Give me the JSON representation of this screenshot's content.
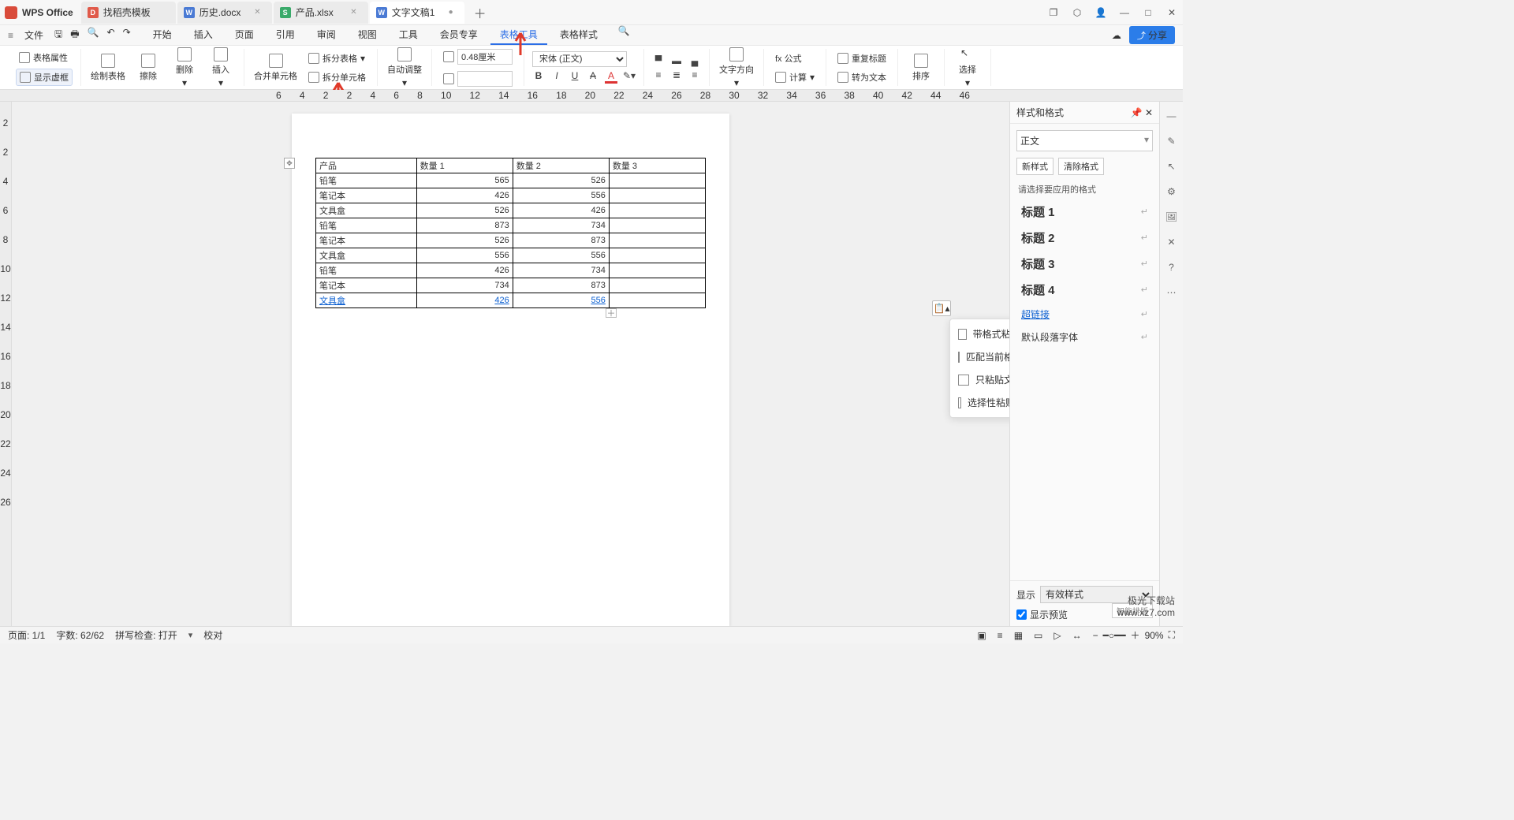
{
  "app": {
    "name": "WPS Office"
  },
  "tabs": [
    {
      "label": "找稻壳模板",
      "icon": "red"
    },
    {
      "label": "历史.docx",
      "icon": "blue"
    },
    {
      "label": "产品.xlsx",
      "icon": "green"
    },
    {
      "label": "文字文稿1",
      "icon": "blue",
      "active": true
    }
  ],
  "win": {
    "box": "❐",
    "cube": "⬚",
    "avatar": "◯",
    "min": "—",
    "max": "❐",
    "close": "✕"
  },
  "qat": {
    "file": "文件"
  },
  "menu": {
    "items": [
      "开始",
      "插入",
      "页面",
      "引用",
      "审阅",
      "视图",
      "工具",
      "会员专享",
      "表格工具",
      "表格样式"
    ],
    "activeIndex": 8
  },
  "menu_right": {
    "share": "分享"
  },
  "ribbon": {
    "tableProps": "表格属性",
    "showBorder": "显示虚框",
    "drawTable": "绘制表格",
    "erase": "擦除",
    "delete": "删除",
    "insert": "插入",
    "merge": "合并单元格",
    "splitTable": "拆分表格",
    "splitCell": "拆分单元格",
    "autoFit": "自动调整",
    "height": "0.48厘米",
    "width": "",
    "font": "宋体 (正文)",
    "fontSize": "",
    "fx": "fx 公式",
    "calc": "计算",
    "repeatHeader": "重复标题",
    "toText": "转为文本",
    "textDir": "文字方向",
    "sort": "排序",
    "select": "选择"
  },
  "ruler_h": [
    "6",
    "4",
    "2",
    "2",
    "4",
    "6",
    "8",
    "10",
    "12",
    "14",
    "16",
    "18",
    "20",
    "22",
    "24",
    "26",
    "28",
    "30",
    "32",
    "34",
    "36",
    "38",
    "40",
    "42",
    "44",
    "46"
  ],
  "ruler_v": [
    "2",
    "2",
    "4",
    "6",
    "8",
    "10",
    "12",
    "14",
    "16",
    "18",
    "20",
    "22",
    "24",
    "26"
  ],
  "table": {
    "headers": [
      "产品",
      "数量 1",
      "数量 2",
      "数量 3"
    ],
    "rows": [
      [
        "铅笔",
        "565",
        "526",
        ""
      ],
      [
        "笔记本",
        "426",
        "556",
        ""
      ],
      [
        "文具盒",
        "526",
        "426",
        ""
      ],
      [
        "铅笔",
        "873",
        "734",
        ""
      ],
      [
        "笔记本",
        "526",
        "873",
        ""
      ],
      [
        "文具盒",
        "556",
        "556",
        ""
      ],
      [
        "铅笔",
        "426",
        "734",
        ""
      ],
      [
        "笔记本",
        "734",
        "873",
        ""
      ],
      [
        "文具盒",
        "426",
        "556",
        ""
      ]
    ],
    "link_row": 8,
    "link_col": 1
  },
  "paste": {
    "withFormat": "带格式粘贴(W)",
    "matchFormat": "匹配当前格式(M)",
    "textOnly": "只粘贴文本(T)",
    "special": "选择性粘贴(S)..."
  },
  "styles": {
    "title": "样式和格式",
    "current": "正文",
    "new": "新样式",
    "clear": "清除格式",
    "hint": "请选择要应用的格式",
    "items": [
      {
        "name": "标题 1",
        "big": true
      },
      {
        "name": "标题 2",
        "big": true
      },
      {
        "name": "标题 3",
        "big": true
      },
      {
        "name": "标题 4",
        "big": true
      },
      {
        "name": "超链接",
        "link": true
      },
      {
        "name": "默认段落字体",
        "normal": true
      }
    ],
    "showLabel": "显示",
    "showValue": "有效样式",
    "preview": "显示预览"
  },
  "status": {
    "page": "页面: 1/1",
    "words": "字数: 62/62",
    "spell": "拼写检查: 打开",
    "proof": "校对",
    "zoom": "90%",
    "smart": "智能排版"
  },
  "watermark": {
    "l1": "极光下载站",
    "l2": "www.xz7.com"
  }
}
